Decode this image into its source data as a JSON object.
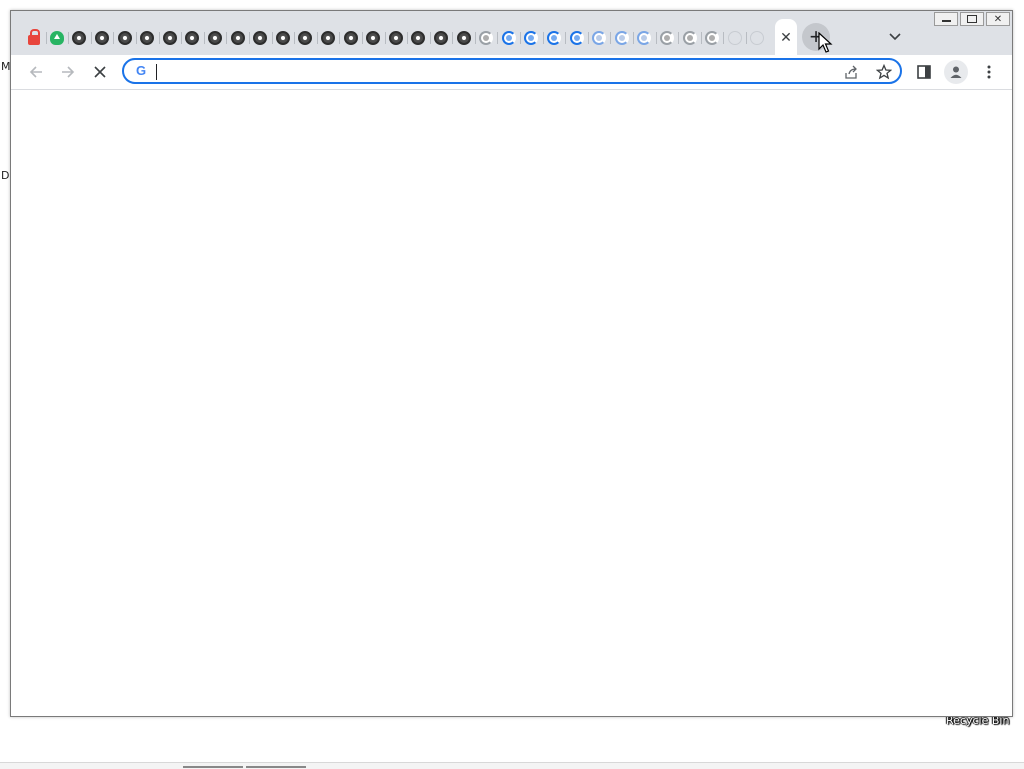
{
  "desktop": {
    "edge_labels": [
      "M",
      "D"
    ],
    "recycle_bin_label": "Recycle Bin"
  },
  "window": {
    "controls": {
      "minimize_icon": "minimize-icon",
      "restore_icon": "restore-icon",
      "close_icon": "close-icon"
    }
  },
  "tab_strip": {
    "tabs": [
      {
        "icon": "lock-icon"
      },
      {
        "icon": "cloud-upload-icon"
      },
      {
        "icon": "chrome-icon"
      },
      {
        "icon": "chrome-icon"
      },
      {
        "icon": "chrome-icon"
      },
      {
        "icon": "chrome-icon"
      },
      {
        "icon": "chrome-icon"
      },
      {
        "icon": "chrome-icon"
      },
      {
        "icon": "chrome-icon"
      },
      {
        "icon": "chrome-icon"
      },
      {
        "icon": "chrome-icon"
      },
      {
        "icon": "chrome-icon"
      },
      {
        "icon": "chrome-icon"
      },
      {
        "icon": "chrome-icon"
      },
      {
        "icon": "chrome-icon"
      },
      {
        "icon": "chrome-icon"
      },
      {
        "icon": "chrome-icon"
      },
      {
        "icon": "chrome-icon"
      },
      {
        "icon": "chrome-icon"
      },
      {
        "icon": "chrome-icon"
      },
      {
        "icon": "loading-spinner-icon"
      },
      {
        "icon": "loading-spinner-icon"
      },
      {
        "icon": "loading-spinner-icon"
      },
      {
        "icon": "loading-spinner-icon"
      },
      {
        "icon": "loading-spinner-icon"
      },
      {
        "icon": "loading-spinner-icon"
      },
      {
        "icon": "loading-spinner-icon"
      },
      {
        "icon": "loading-spinner-icon"
      },
      {
        "icon": "loading-spinner-icon"
      },
      {
        "icon": "loading-spinner-icon"
      },
      {
        "icon": "loading-spinner-icon"
      },
      {
        "icon": "blank-tab-icon"
      },
      {
        "icon": "blank-tab-icon"
      }
    ],
    "active_tab": {
      "title": "",
      "close_icon": "close-icon"
    },
    "new_tab_icon": "plus-icon",
    "tab_search_icon": "chevron-down-icon"
  },
  "toolbar": {
    "back_icon": "back-arrow-icon",
    "forward_icon": "forward-arrow-icon",
    "stop_icon": "stop-loading-icon",
    "omnibox": {
      "value": "",
      "placeholder": "",
      "search_engine_icon": "google-g-icon",
      "share_icon": "share-icon",
      "bookmark_icon": "star-icon"
    },
    "side_panel_icon": "side-panel-icon",
    "profile_icon": "profile-avatar-icon",
    "menu_icon": "kebab-menu-icon"
  },
  "colors": {
    "accent": "#1a73e8",
    "titlebar_bg": "#dee1e6",
    "tab_icon_dark": "#2d2d2d",
    "lock_red": "#e8453c",
    "cloud_green": "#28b463"
  }
}
